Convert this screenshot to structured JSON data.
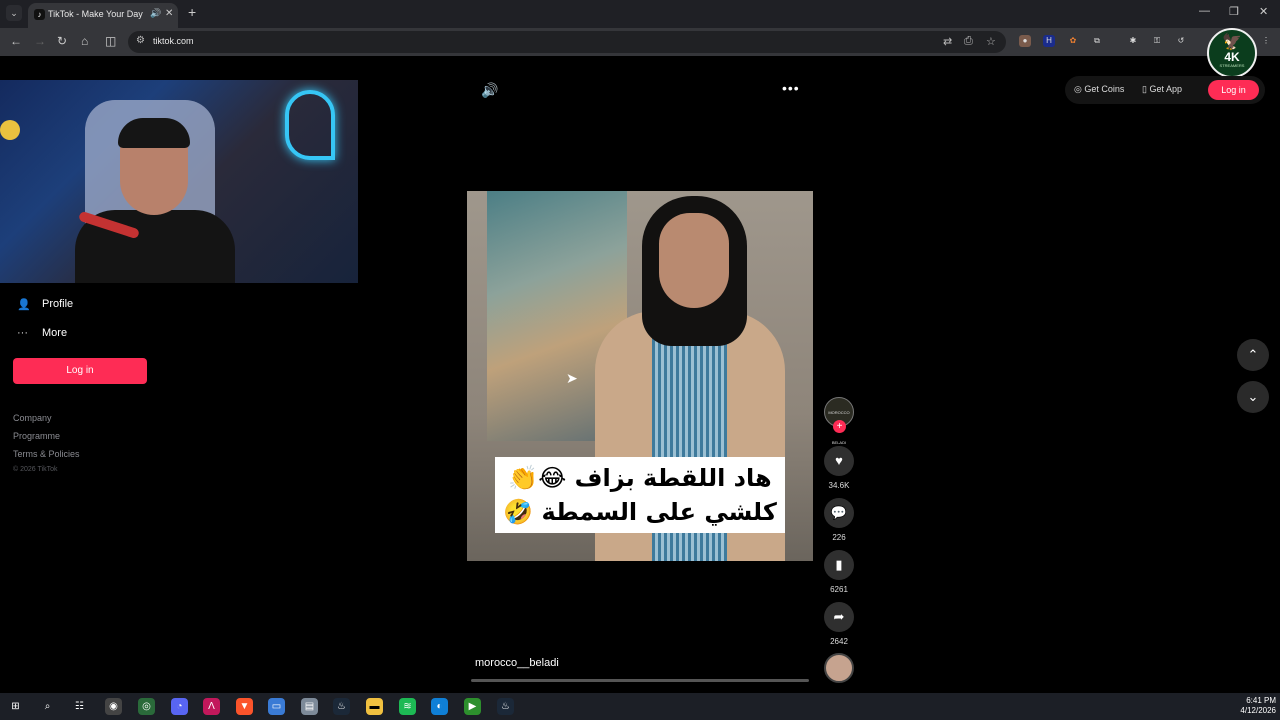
{
  "browser": {
    "tab_title": "TikTok - Make Your Day",
    "url": "tiktok.com"
  },
  "channel_badge": {
    "text": "4K",
    "subtext": "STREAMERS"
  },
  "sidebar": {
    "items": [
      {
        "label": "Profile",
        "icon": "person-icon"
      },
      {
        "label": "More",
        "icon": "ellipsis-icon"
      }
    ],
    "login_label": "Log in",
    "footer_links": [
      "Company",
      "Programme",
      "Terms & Policies"
    ],
    "copyright": "© 2026 TikTok"
  },
  "header_actions": {
    "get_coins": "Get Coins",
    "get_app": "Get App",
    "login": "Log in"
  },
  "video": {
    "caption_line1": "هاد اللقطة بزاف 😂👏",
    "caption_line2": "كلشي على السمطة 🤣",
    "username": "morocco__beladi",
    "creator_avatar_text": "MOROCCO BELADI",
    "likes": "34.6K",
    "comments": "226",
    "saves": "6261",
    "shares": "2642"
  },
  "taskbar": {
    "time": "6:41 PM",
    "date": "4/12/2026"
  },
  "colors": {
    "accent": "#fe2c55",
    "background": "#000000",
    "chrome": "#35363a"
  }
}
